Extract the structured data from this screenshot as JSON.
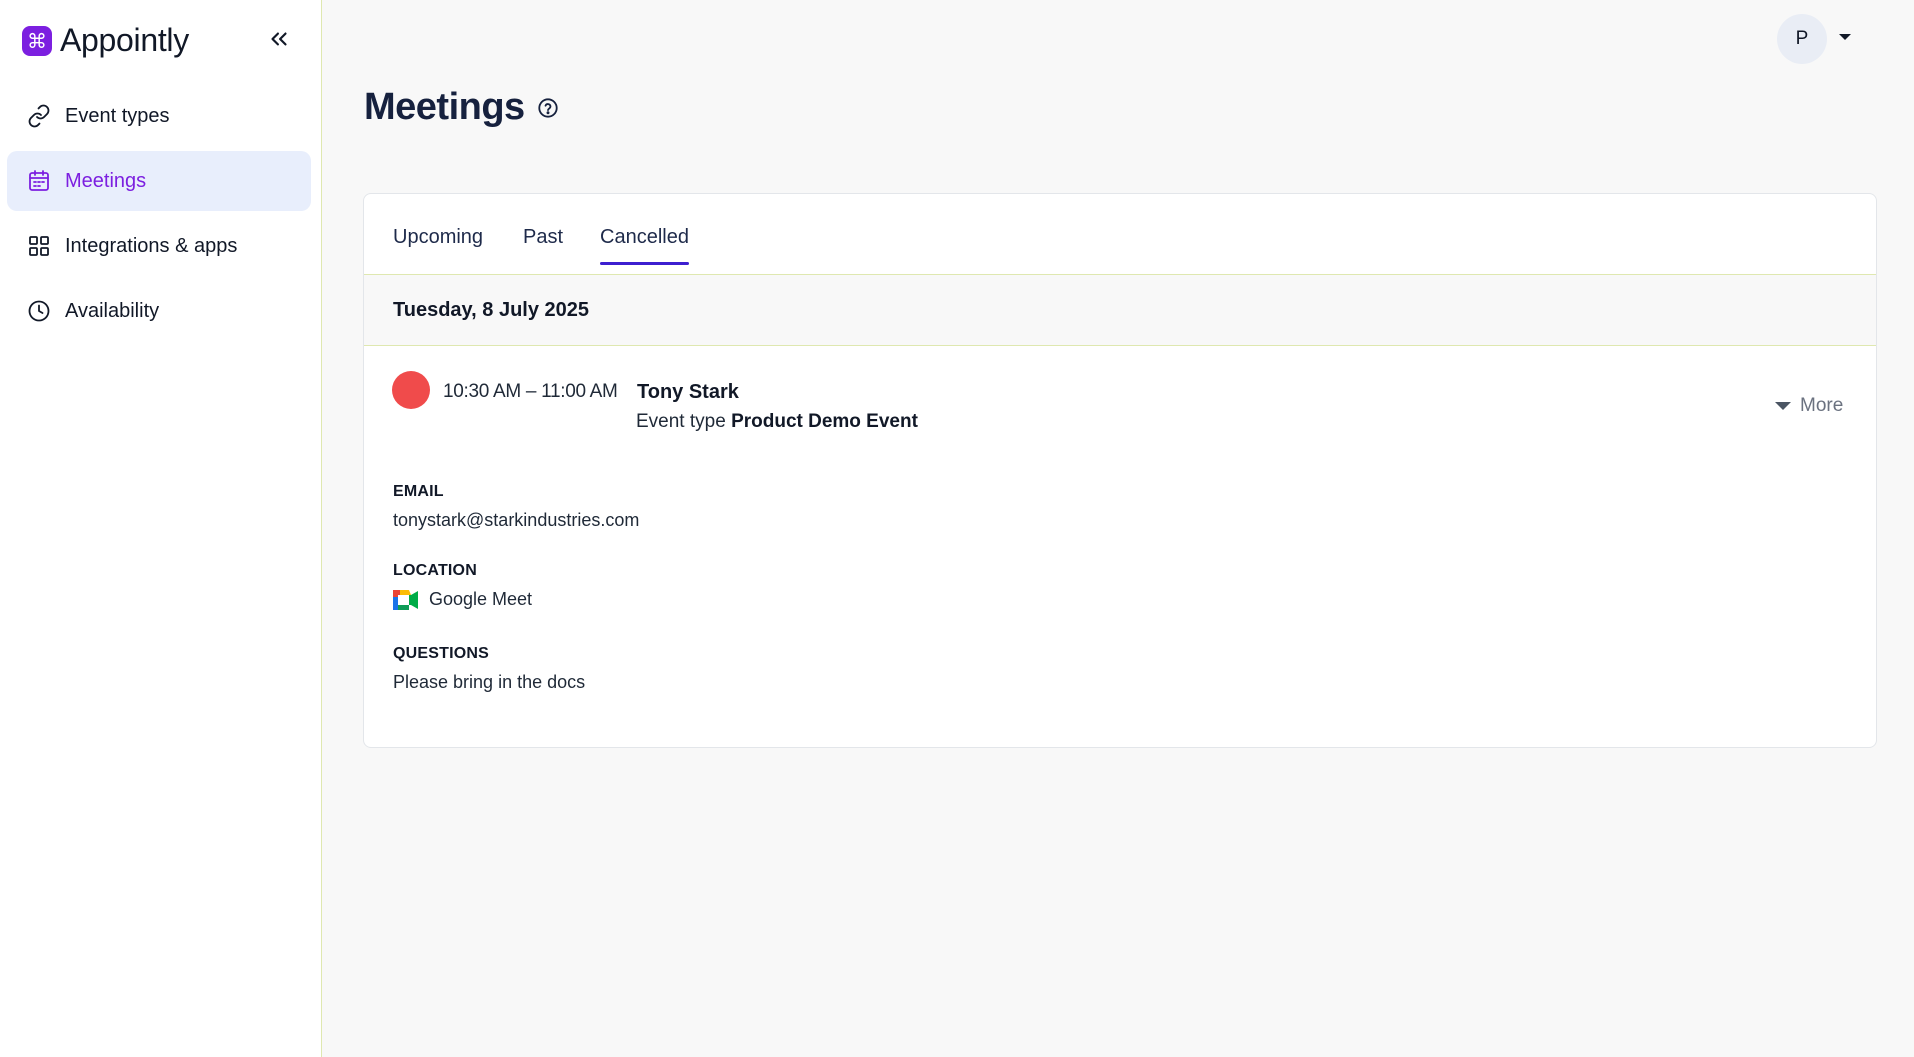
{
  "app": {
    "name": "Appointly",
    "logo_glyph": "⌘",
    "brand_color": "#7c1fe0"
  },
  "sidebar": {
    "collapse_icon": "double-chevron-left-icon",
    "items": [
      {
        "label": "Event types",
        "icon": "link-icon",
        "active": false
      },
      {
        "label": "Meetings",
        "icon": "calendar-icon",
        "active": true
      },
      {
        "label": "Integrations & apps",
        "icon": "grid-icon",
        "active": false
      },
      {
        "label": "Availability",
        "icon": "clock-icon",
        "active": false
      }
    ]
  },
  "header": {
    "avatar_initial": "P",
    "avatar_caret_icon": "caret-down-icon"
  },
  "page": {
    "title": "Meetings",
    "help_icon": "help-circle-icon"
  },
  "tabs": [
    {
      "label": "Upcoming",
      "active": false
    },
    {
      "label": "Past",
      "active": false
    },
    {
      "label": "Cancelled",
      "active": true
    }
  ],
  "meetings": {
    "date": "Tuesday, 8 July 2025",
    "item": {
      "status_color": "#f04b4b",
      "time": "10:30 AM – 11:00 AM",
      "attendee": "Tony Stark",
      "event_type_prefix": "Event type",
      "event_type_name": "Product Demo Event",
      "more_label": "More",
      "email_label": "EMAIL",
      "email": "tonystark@starkindustries.com",
      "location_label": "LOCATION",
      "location": "Google Meet",
      "location_icon": "google-meet-icon",
      "questions_label": "QUESTIONS",
      "questions": "Please bring in the docs"
    }
  }
}
